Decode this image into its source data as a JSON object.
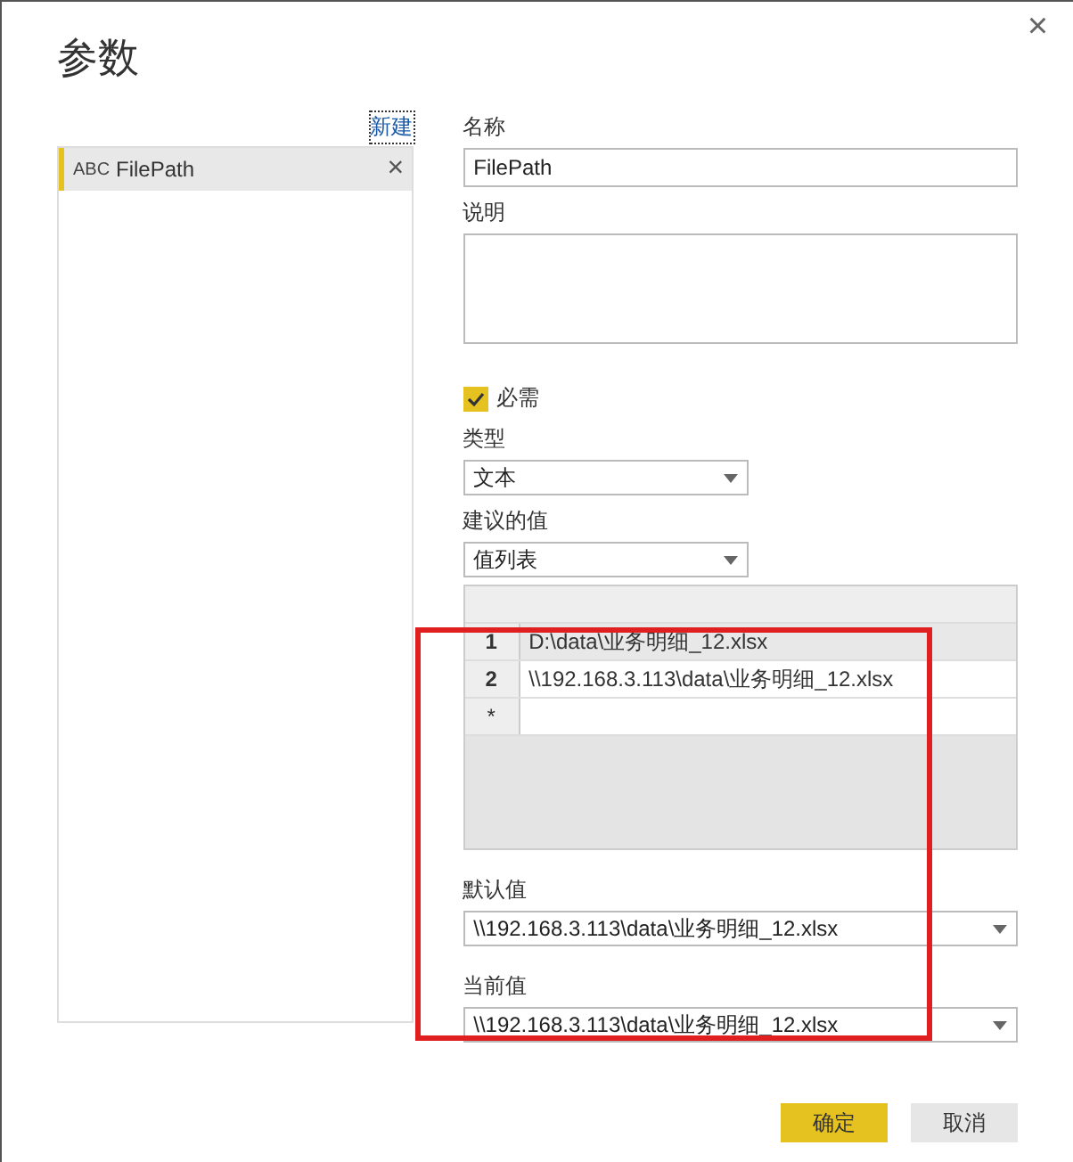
{
  "dialog": {
    "title": "参数",
    "close": "×"
  },
  "sidebar": {
    "new_link": "新建",
    "items": [
      {
        "type_icon": "ABC",
        "name": "FilePath",
        "delete": "×",
        "selected": true
      }
    ]
  },
  "form": {
    "name_label": "名称",
    "name_value": "FilePath",
    "description_label": "说明",
    "required": {
      "label": "必需",
      "checked": true
    },
    "type_label": "类型",
    "type_value": "文本",
    "suggested_label": "建议的值",
    "suggested_value": "值列表",
    "table": {
      "rows": [
        {
          "index": "1",
          "value": "D:\\data\\业务明细_12.xlsx",
          "selected": true
        },
        {
          "index": "2",
          "value": "\\\\192.168.3.113\\data\\业务明细_12.xlsx",
          "selected": false
        }
      ],
      "new_row_marker": "*"
    },
    "default_label": "默认值",
    "default_value": "\\\\192.168.3.113\\data\\业务明细_12.xlsx",
    "current_label": "当前值",
    "current_value": "\\\\192.168.3.113\\data\\业务明细_12.xlsx"
  },
  "buttons": [
    {
      "label": "确定",
      "kind": "primary"
    },
    {
      "label": "取消",
      "kind": "secondary"
    }
  ]
}
